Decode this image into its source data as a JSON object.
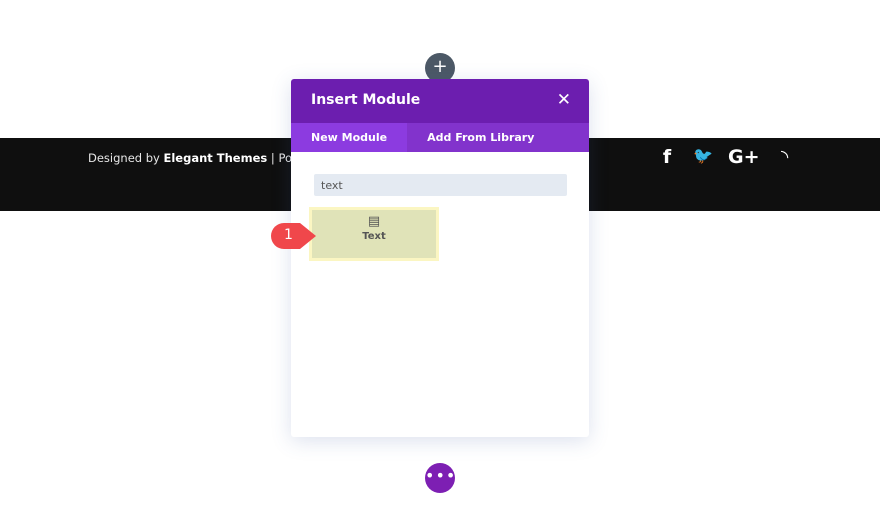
{
  "footer": {
    "designed_by": "Designed by",
    "brand": "Elegant Themes",
    "separator": "|",
    "powered": "Powered b",
    "social": [
      {
        "icon": "facebook-icon",
        "glyph": "f"
      },
      {
        "icon": "twitter-icon",
        "glyph": "🐦"
      },
      {
        "icon": "google-plus-icon",
        "glyph": "G+"
      },
      {
        "icon": "rss-icon",
        "glyph": "◝"
      }
    ]
  },
  "add_button": {
    "glyph": "+"
  },
  "modal": {
    "title": "Insert Module",
    "close": "✕",
    "tabs": [
      {
        "label": "New Module",
        "active": true
      },
      {
        "label": "Add From Library",
        "active": false
      }
    ],
    "search_value": "text",
    "results": [
      {
        "label": "Text",
        "icon": "document-icon",
        "glyph": "▤"
      }
    ]
  },
  "badge": {
    "number": "1",
    "color": "#f0474b"
  },
  "more_button": {
    "glyph": "•••"
  },
  "colors": {
    "header": "#6c1eaf",
    "tabs": "#8233cc",
    "active_tab": "#8c3be0",
    "footer": "#0f0f0f",
    "more": "#7d1fb3"
  }
}
